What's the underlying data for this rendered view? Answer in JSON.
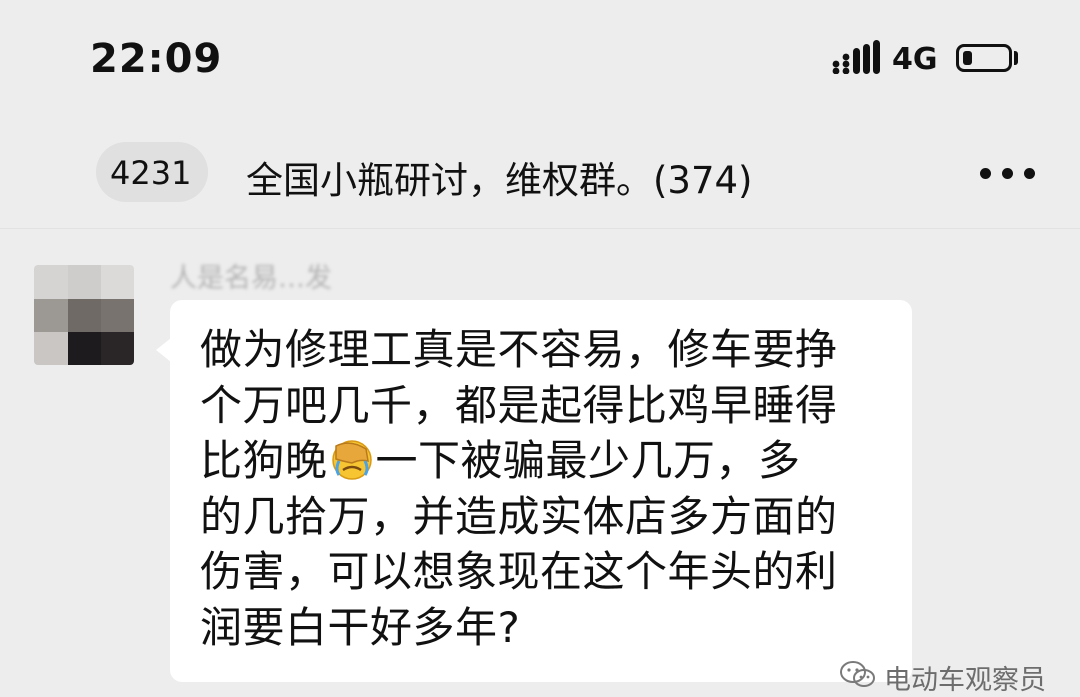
{
  "status_bar": {
    "time": "22:09",
    "network": "4G",
    "icons": [
      "signal-icon",
      "battery-icon"
    ]
  },
  "nav": {
    "back_count": "4231",
    "title": "全国小瓶研讨，维权群。(374)",
    "more_icon": "more-dots-icon"
  },
  "message": {
    "sender": "人是名易…发",
    "lines": [
      "做为修理工真是不容易，修车要挣",
      "个万吧几千，都是起得比鸡早睡得",
      "比狗晚",
      "一下被骗最少几万，多",
      "的几拾万，并造成实体店多方面的",
      "伤害，可以想象现在这个年头的利",
      "润要白干好多年?"
    ],
    "emoji": "facepalm-crying-emoji"
  },
  "watermark": {
    "text": "电动车观察员",
    "icon": "wechat-icon"
  },
  "colors": {
    "background": "#ededed",
    "bubble": "#ffffff",
    "text": "#111111"
  }
}
